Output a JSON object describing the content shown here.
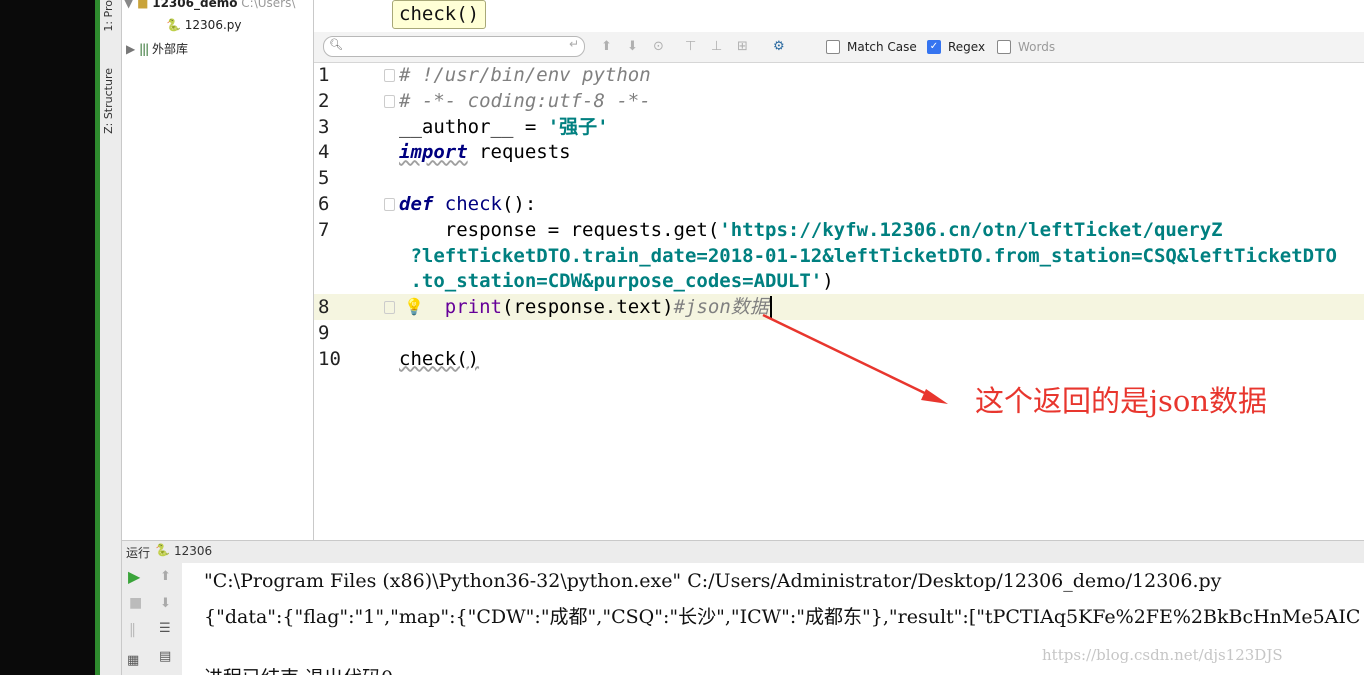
{
  "sidebar_tabs": {
    "project": "1: Pro",
    "structure": "Z: Structure"
  },
  "project_tree": {
    "root_name": "12306_demo",
    "root_path": "C:\\Users\\",
    "file": "12306.py",
    "external_libs": "外部库"
  },
  "tooltip": "check()",
  "search_bar": {
    "match_case_label": "Match Case",
    "match_case_checked": false,
    "regex_label": "Regex",
    "regex_checked": true,
    "words_label": "Words",
    "words_checked": false
  },
  "code_lines": [
    {
      "num": "1",
      "text": "# !/usr/bin/env python"
    },
    {
      "num": "2",
      "text": "# -*- coding:utf-8 -*-"
    },
    {
      "num": "3",
      "text": "__author__ = '强子'"
    },
    {
      "num": "4",
      "text": "import requests"
    },
    {
      "num": "5",
      "text": ""
    },
    {
      "num": "6",
      "text": "def check():"
    },
    {
      "num": "7",
      "text": "    response = requests.get('https://kyfw.12306.cn/otn/leftTicket/queryZ"
    },
    {
      "num": "",
      "text": " ?leftTicketDTO.train_date=2018-01-12&leftTicketDTO.from_station=CSQ&leftTicketDTO"
    },
    {
      "num": "",
      "text": " .to_station=CDW&purpose_codes=ADULT')"
    },
    {
      "num": "8",
      "text": "    print(response.text)#json数据"
    },
    {
      "num": "9",
      "text": ""
    },
    {
      "num": "10",
      "text": "check()"
    }
  ],
  "annotation": "这个返回的是json数据",
  "run_panel": {
    "label": "运行",
    "config": "12306",
    "output": [
      "\"C:\\Program Files (x86)\\Python36-32\\python.exe\" C:/Users/Administrator/Desktop/12306_demo/12306.py",
      "{\"data\":{\"flag\":\"1\",\"map\":{\"CDW\":\"成都\",\"CSQ\":\"长沙\",\"ICW\":\"成都东\"},\"result\":[\"tPCTIAq5KFe%2FE%2BkBcHnMe5AIC",
      "",
      "进程已结束,退出代码0"
    ]
  },
  "watermark": "https://blog.csdn.net/djs123DJS",
  "colors": {
    "annotation": "#e8362e",
    "run_green": "#3aa43a",
    "checkbox_blue": "#3574f0"
  }
}
